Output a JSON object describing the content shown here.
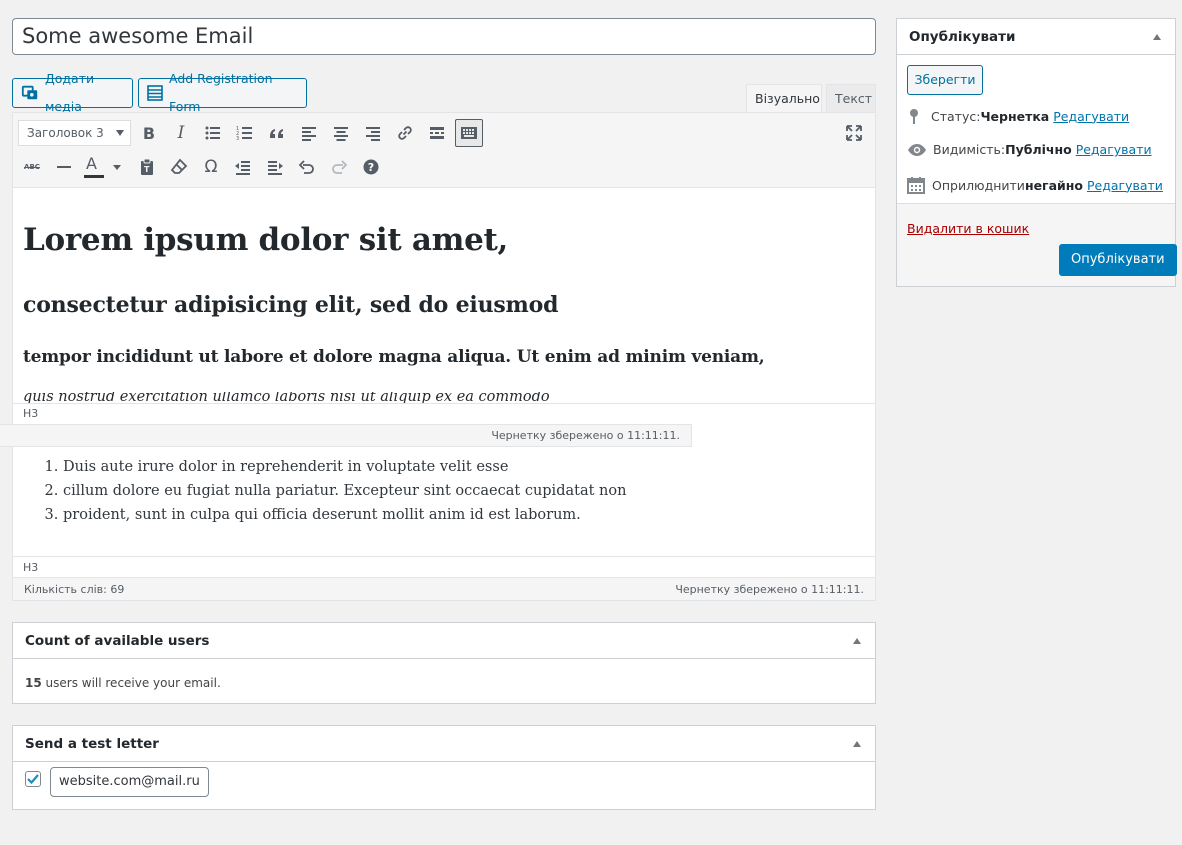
{
  "title": {
    "value": "Some awesome Email"
  },
  "media_buttons": {
    "add_media": "Додати медіа",
    "add_registration_form": "Add Registration Form"
  },
  "editor_tabs": {
    "visual": "Візуально",
    "text": "Текст"
  },
  "toolbar": {
    "format_select": "Заголовок 3",
    "icons_row1": [
      "bold-icon",
      "italic-icon",
      "bulleted-list-icon",
      "numbered-list-icon",
      "blockquote-icon",
      "align-left-icon",
      "align-center-icon",
      "align-right-icon",
      "link-icon",
      "read-more-icon",
      "toolbar-toggle-icon",
      "fullscreen-icon"
    ],
    "icons_row2": [
      "strikethrough-icon",
      "horizontal-line-icon",
      "text-color-icon",
      "paste-text-icon",
      "clear-formatting-icon",
      "special-character-icon",
      "outdent-icon",
      "indent-icon",
      "undo-icon",
      "redo-icon",
      "help-icon"
    ],
    "bold_glyph": "B",
    "italic_glyph": "I",
    "omega_glyph": "Ω",
    "strike_glyph": "ABC",
    "text_color_glyph": "A"
  },
  "content": {
    "h1": "Lorem ipsum dolor sit amet,",
    "h2": "consectetur adipisicing elit, sed do eiusmod",
    "h3": "tempor incididunt ut labore et dolore magna aliqua. Ut enim ad minim veniam,",
    "italic_line": "quis nostrud exercitation ullamco laboris nisi ut aliquip ex ea commodo",
    "list": [
      "Duis aute irure dolor in reprehenderit in voluptate velit esse",
      "cillum dolore eu fugiat nulla pariatur. Excepteur sint occaecat cupidatat non",
      "proident, sunt in culpa qui officia deserunt mollit anim id est laborum."
    ],
    "path_tag_1": "H3",
    "path_tag_2": "H3"
  },
  "ghost_status": {
    "text": "Чернетку збережено о 11:11:11."
  },
  "statusbar": {
    "word_count": "Кількість слів: 69",
    "draft_saved": "Чернетку збережено о 11:11:11."
  },
  "count_box": {
    "title": "Count of available users",
    "count": "15",
    "text": " users will receive your email."
  },
  "test_box": {
    "title": "Send a test letter",
    "email": "website.com@mail.ru",
    "checked": true
  },
  "publish": {
    "title": "Опублікувати",
    "save_button": "Зберегти",
    "status_label": "Статус: ",
    "status_value": "Чернетка",
    "visibility_label": "Видимість: ",
    "visibility_value": "Публічно",
    "publish_label": "Оприлюднити ",
    "publish_value": "негайно",
    "edit_link": "Редагувати",
    "trash_link": "Видалити в кошик",
    "publish_button": "Опублікувати"
  },
  "colors": {
    "primary": "#007cba",
    "link": "#0073aa",
    "trash": "#a00",
    "background": "#f1f1f1"
  }
}
